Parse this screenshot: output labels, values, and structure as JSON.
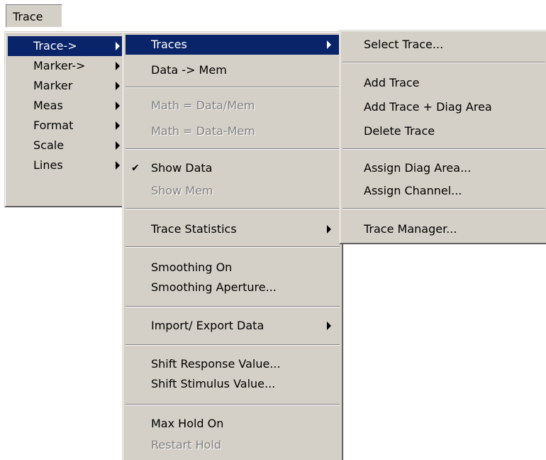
{
  "menubar": {
    "trace_label": "Trace"
  },
  "menu1": {
    "items": [
      {
        "label": "Trace->"
      },
      {
        "label": "Marker->"
      },
      {
        "label": "Marker"
      },
      {
        "label": "Meas"
      },
      {
        "label": "Format"
      },
      {
        "label": "Scale"
      },
      {
        "label": "Lines"
      }
    ]
  },
  "menu2": {
    "items": [
      {
        "label": "Traces"
      },
      {
        "label": "Data -> Mem"
      },
      {
        "label": "Math = Data/Mem"
      },
      {
        "label": "Math = Data-Mem"
      },
      {
        "label": "Show Data"
      },
      {
        "label": "Show Mem"
      },
      {
        "label": "Trace Statistics"
      },
      {
        "label": "Smoothing On"
      },
      {
        "label": "Smoothing Aperture..."
      },
      {
        "label": "Import/ Export Data"
      },
      {
        "label": "Shift Response Value..."
      },
      {
        "label": "Shift Stimulus Value..."
      },
      {
        "label": "Max Hold On"
      },
      {
        "label": "Restart Hold"
      }
    ],
    "check_glyph": "✔"
  },
  "menu3": {
    "items": [
      {
        "label": "Select Trace..."
      },
      {
        "label": "Add Trace"
      },
      {
        "label": "Add Trace + Diag Area"
      },
      {
        "label": "Delete Trace"
      },
      {
        "label": "Assign Diag Area..."
      },
      {
        "label": "Assign Channel..."
      },
      {
        "label": "Trace Manager..."
      }
    ]
  },
  "colors": {
    "menu_bg": "#d4d0c8",
    "highlight_bg": "#0a246a",
    "highlight_text": "#ffffff",
    "disabled_text": "#808080"
  }
}
